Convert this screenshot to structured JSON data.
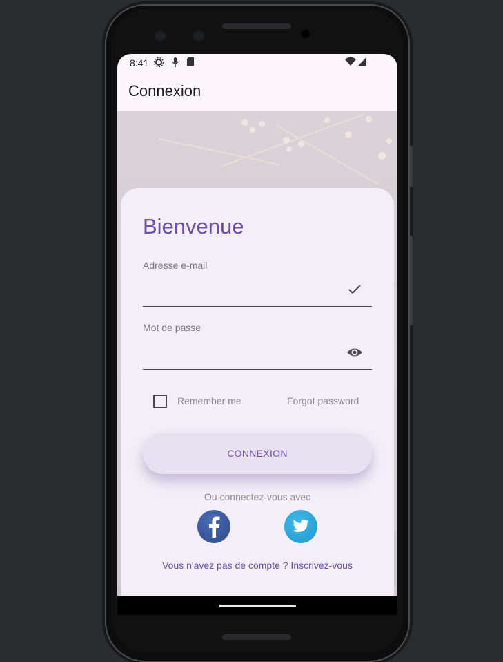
{
  "status_bar": {
    "time": "8:41"
  },
  "app_bar": {
    "title": "Connexion"
  },
  "login": {
    "heading": "Bienvenue",
    "email_label": "Adresse e-mail",
    "password_label": "Mot de passe",
    "remember_label": "Remember me",
    "forgot_label": "Forgot password",
    "login_button": "CONNEXION",
    "or_text": "Ou connectez-vous avec",
    "signup_text": "Vous n'avez pas de compte ? Inscrivez-vous"
  },
  "colors": {
    "accent": "#6b4ea8",
    "facebook": "#3b5998",
    "twitter": "#1da1f2"
  }
}
